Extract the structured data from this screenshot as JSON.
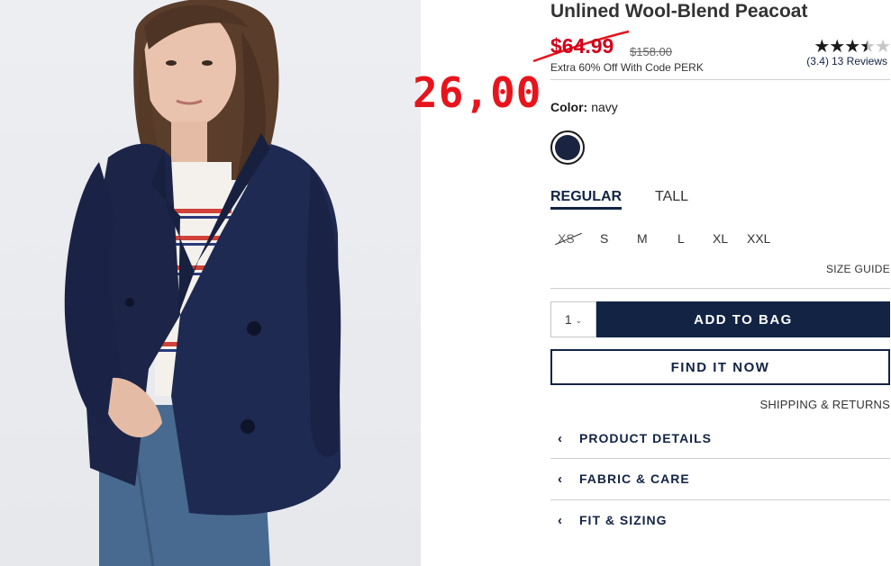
{
  "product": {
    "title": "Unlined Wool-Blend Peacoat",
    "sale_price": "$64.99",
    "original_price": "$158.00",
    "promo": "Extra 60% Off With Code PERK",
    "rating_value": 3.4,
    "rating_text": "(3.4)",
    "reviews_text": "13 Reviews",
    "stars": "★★★",
    "half_star": "★",
    "empty_stars": "★"
  },
  "annotation": {
    "handwritten_price": "26,00",
    "color": "#e8141c"
  },
  "color": {
    "label": "Color:",
    "value": "navy",
    "swatch_hex": "#1a2440"
  },
  "fit_tabs": [
    {
      "label": "REGULAR",
      "active": true
    },
    {
      "label": "TALL",
      "active": false
    }
  ],
  "sizes": [
    "XS",
    "S",
    "M",
    "L",
    "XL",
    "XXL"
  ],
  "size_guide": "SIZE GUIDE",
  "quantity": "1",
  "buttons": {
    "add_to_bag": "ADD TO BAG",
    "find_it_now": "FIND IT NOW"
  },
  "shipping_returns": "SHIPPING & RETURNS",
  "accordions": [
    {
      "label": "PRODUCT DETAILS"
    },
    {
      "label": "FABRIC & CARE"
    },
    {
      "label": "FIT & SIZING"
    }
  ],
  "theme": {
    "navy": "#122344",
    "sale_red": "#d0021b"
  }
}
